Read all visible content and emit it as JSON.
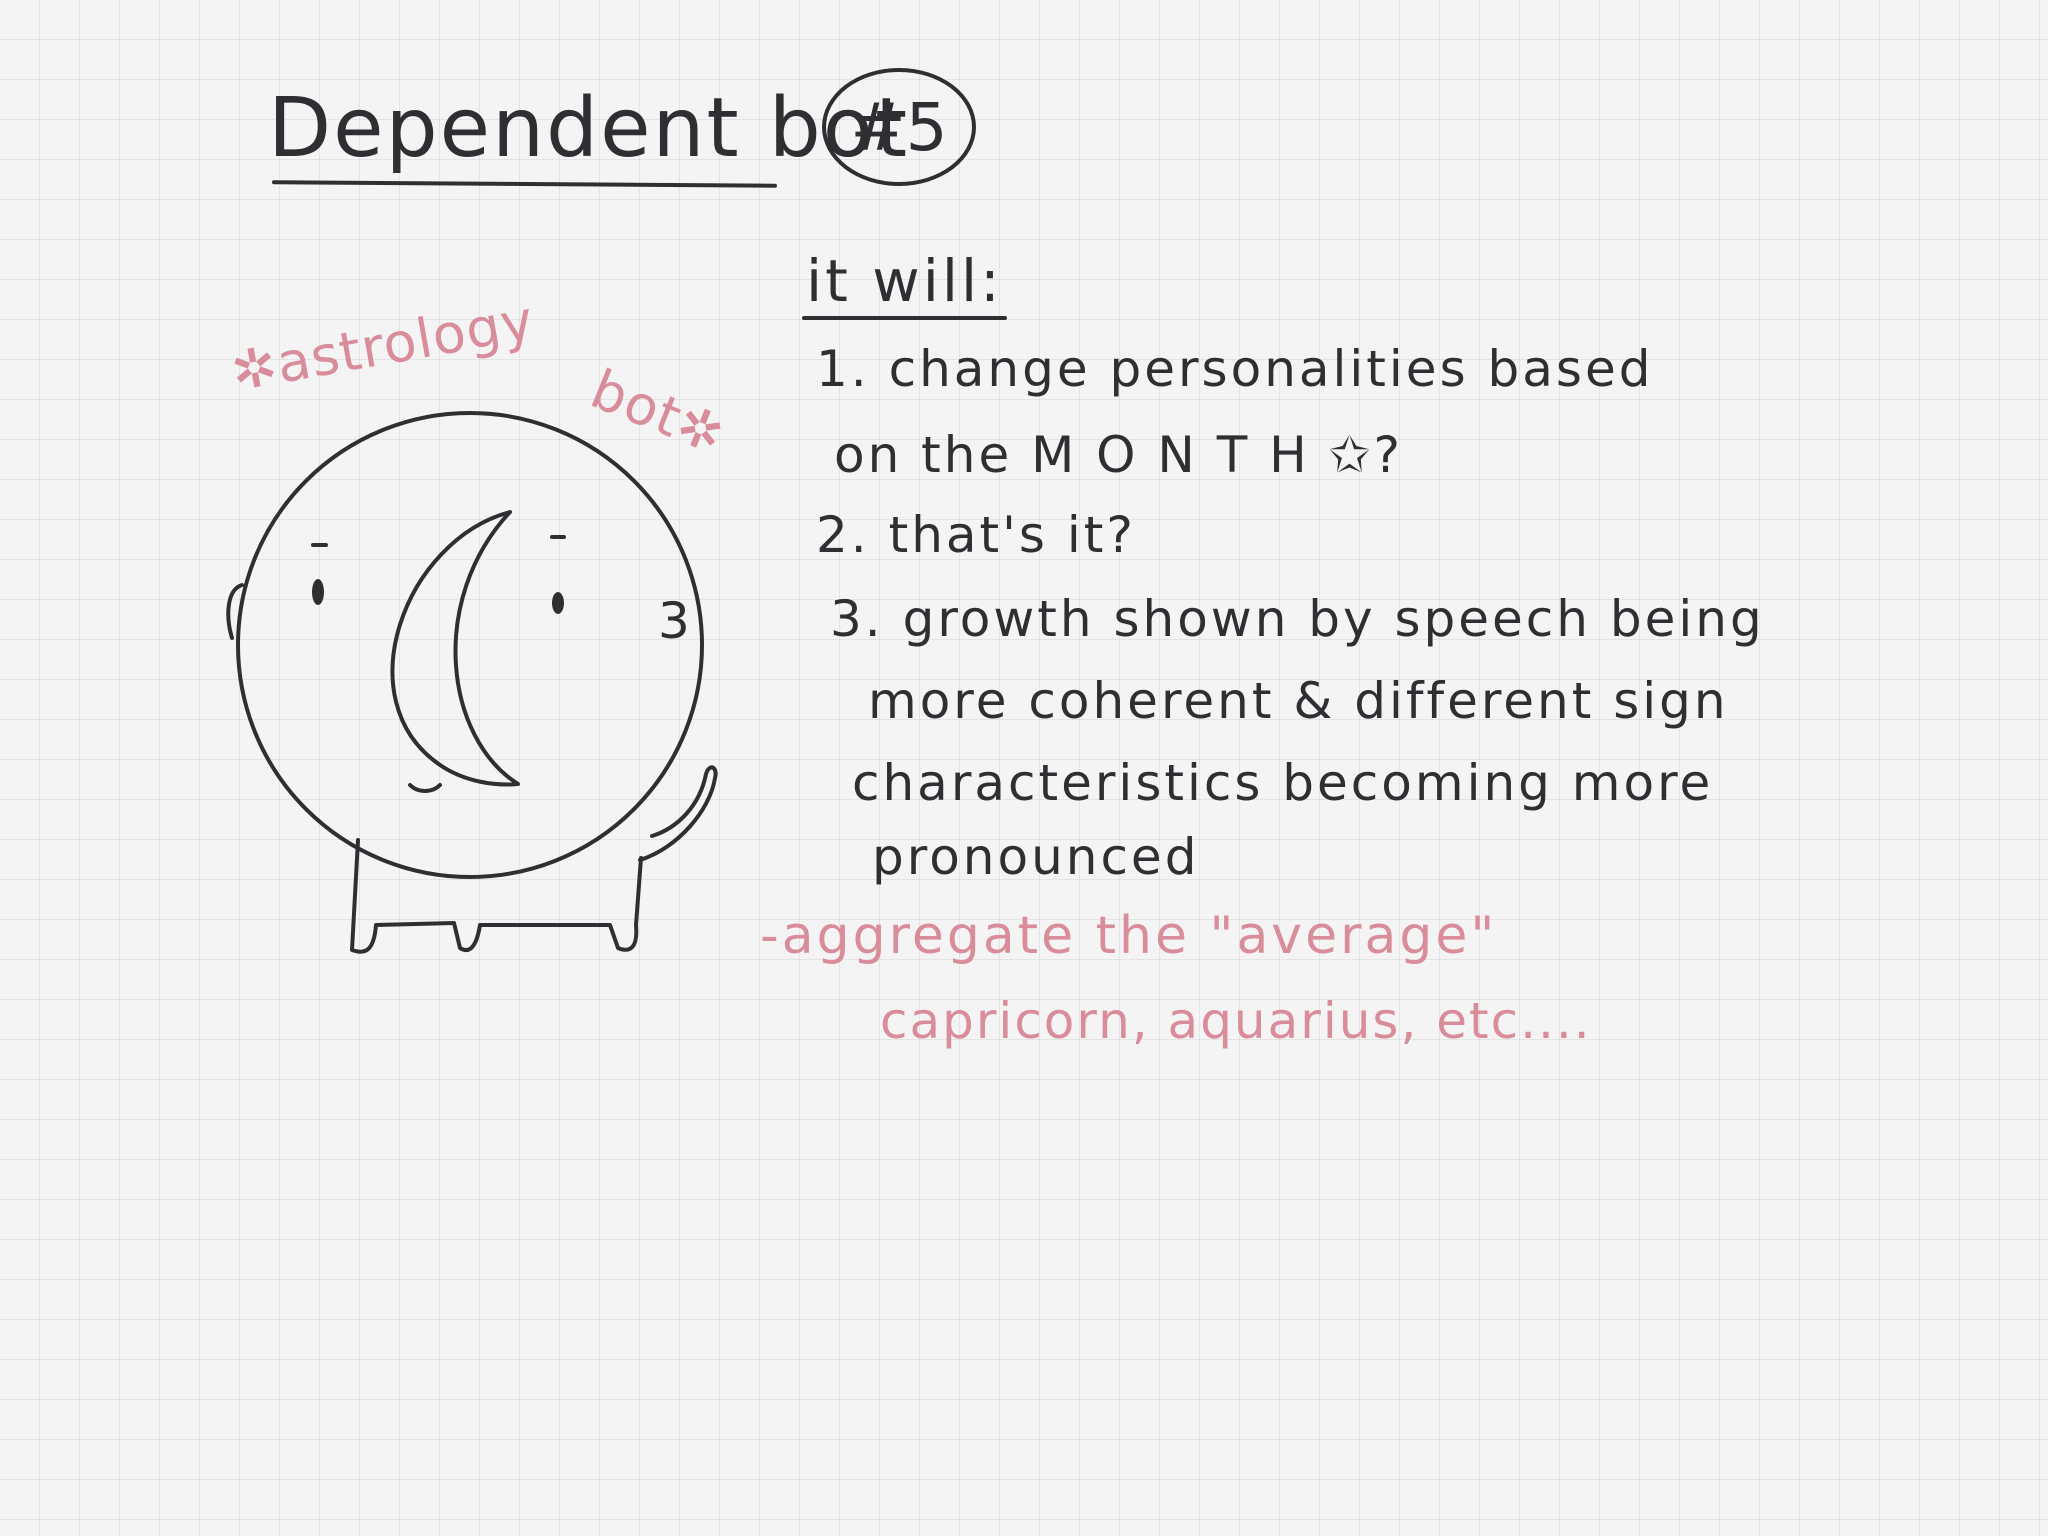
{
  "title": "Dependent bot",
  "badge": "#5",
  "robot": {
    "label": "✲astrology",
    "label_2": "bot✲",
    "ear_mark": "3"
  },
  "notes": {
    "heading": "it will:",
    "lines": [
      "1. change personalities based",
      "on the M O N T H ✩?",
      "2. that's it?",
      "3. growth shown by speech being",
      "more coherent & different sign",
      "characteristics becoming more",
      "pronounced"
    ],
    "aside": [
      "-aggregate the \"average\"",
      "capricorn, aquarius, etc...."
    ]
  },
  "colors": {
    "ink": "#2f2f33",
    "pink": "#d98c99",
    "paper": "#f4f4f4",
    "grid": "#e2e2e2"
  }
}
